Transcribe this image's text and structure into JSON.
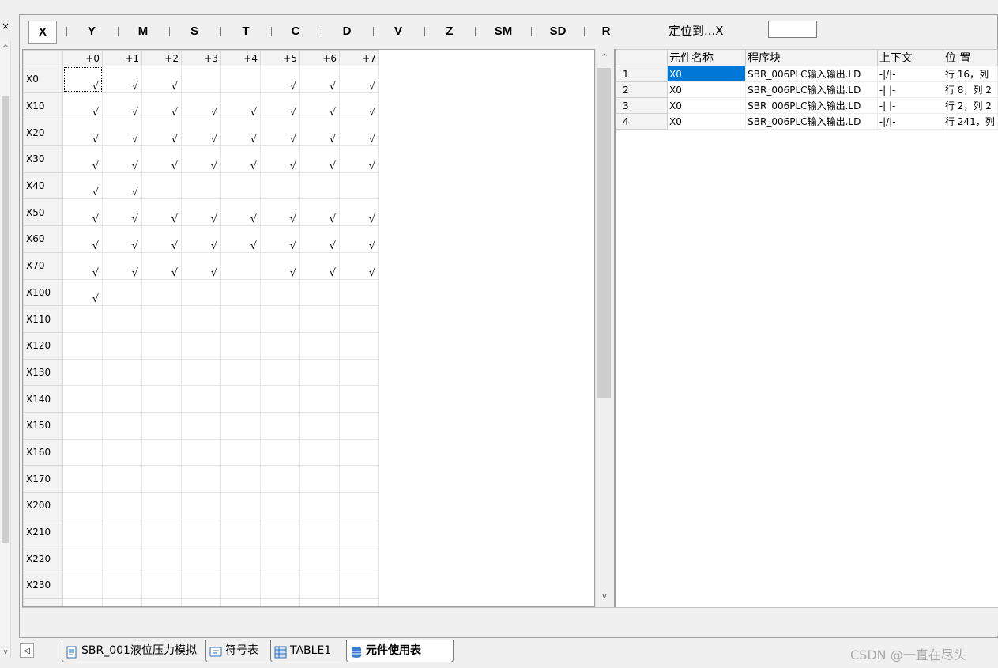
{
  "left_strip": {
    "close_glyph": "×",
    "up_glyph": "^",
    "down_glyph": "v"
  },
  "type_tabs": [
    {
      "label": "X",
      "active": true
    },
    {
      "label": "Y"
    },
    {
      "label": "M"
    },
    {
      "label": "S"
    },
    {
      "label": "T"
    },
    {
      "label": "C"
    },
    {
      "label": "D"
    },
    {
      "label": "V"
    },
    {
      "label": "Z"
    },
    {
      "label": "SM"
    },
    {
      "label": "SD"
    },
    {
      "label": "R"
    }
  ],
  "locate": {
    "label": "定位到...X",
    "value": ""
  },
  "grid": {
    "columns": [
      "+0",
      "+1",
      "+2",
      "+3",
      "+4",
      "+5",
      "+6",
      "+7"
    ],
    "check_mark": "√",
    "rows": [
      {
        "label": "X0",
        "used": [
          1,
          1,
          1,
          0,
          0,
          1,
          1,
          1
        ]
      },
      {
        "label": "X10",
        "used": [
          1,
          1,
          1,
          1,
          1,
          1,
          1,
          1
        ]
      },
      {
        "label": "X20",
        "used": [
          1,
          1,
          1,
          1,
          1,
          1,
          1,
          1
        ]
      },
      {
        "label": "X30",
        "used": [
          1,
          1,
          1,
          1,
          1,
          1,
          1,
          1
        ]
      },
      {
        "label": "X40",
        "used": [
          1,
          1,
          0,
          0,
          0,
          0,
          0,
          0
        ]
      },
      {
        "label": "X50",
        "used": [
          1,
          1,
          1,
          1,
          1,
          1,
          1,
          1
        ]
      },
      {
        "label": "X60",
        "used": [
          1,
          1,
          1,
          1,
          1,
          1,
          1,
          1
        ]
      },
      {
        "label": "X70",
        "used": [
          1,
          1,
          1,
          1,
          0,
          1,
          1,
          1
        ]
      },
      {
        "label": "X100",
        "used": [
          1,
          0,
          0,
          0,
          0,
          0,
          0,
          0
        ]
      },
      {
        "label": "X110",
        "used": [
          0,
          0,
          0,
          0,
          0,
          0,
          0,
          0
        ]
      },
      {
        "label": "X120",
        "used": [
          0,
          0,
          0,
          0,
          0,
          0,
          0,
          0
        ]
      },
      {
        "label": "X130",
        "used": [
          0,
          0,
          0,
          0,
          0,
          0,
          0,
          0
        ]
      },
      {
        "label": "X140",
        "used": [
          0,
          0,
          0,
          0,
          0,
          0,
          0,
          0
        ]
      },
      {
        "label": "X150",
        "used": [
          0,
          0,
          0,
          0,
          0,
          0,
          0,
          0
        ]
      },
      {
        "label": "X160",
        "used": [
          0,
          0,
          0,
          0,
          0,
          0,
          0,
          0
        ]
      },
      {
        "label": "X170",
        "used": [
          0,
          0,
          0,
          0,
          0,
          0,
          0,
          0
        ]
      },
      {
        "label": "X200",
        "used": [
          0,
          0,
          0,
          0,
          0,
          0,
          0,
          0
        ]
      },
      {
        "label": "X210",
        "used": [
          0,
          0,
          0,
          0,
          0,
          0,
          0,
          0
        ]
      },
      {
        "label": "X220",
        "used": [
          0,
          0,
          0,
          0,
          0,
          0,
          0,
          0
        ]
      },
      {
        "label": "X230",
        "used": [
          0,
          0,
          0,
          0,
          0,
          0,
          0,
          0
        ]
      },
      {
        "label": "",
        "used": [
          0,
          0,
          0,
          0,
          0,
          0,
          0,
          0
        ]
      }
    ]
  },
  "vscroll": {
    "up_glyph": "^",
    "down_glyph": "v"
  },
  "usage": {
    "headers": [
      "",
      "元件名称",
      "程序块",
      "上下文",
      "位 置"
    ],
    "rows": [
      {
        "idx": "1",
        "name": "X0",
        "block": "SBR_006PLC输入输出.LD",
        "context": "-|/|-",
        "position": "行 16，列"
      },
      {
        "idx": "2",
        "name": "X0",
        "block": "SBR_006PLC输入输出.LD",
        "context": "-| |-",
        "position": "行 8，列 2"
      },
      {
        "idx": "3",
        "name": "X0",
        "block": "SBR_006PLC输入输出.LD",
        "context": "-| |-",
        "position": "行 2，列 2"
      },
      {
        "idx": "4",
        "name": "X0",
        "block": "SBR_006PLC输入输出.LD",
        "context": "-|/|-",
        "position": "行 241，列"
      }
    ],
    "selected_row": 0
  },
  "bottom_tabs": {
    "nav_left": "◁",
    "tabs": [
      {
        "label": "SBR_001液位压力模拟",
        "icon": "ladder-program-icon"
      },
      {
        "label": "符号表",
        "icon": "symbol-table-icon"
      },
      {
        "label": "TABLE1",
        "icon": "table-icon"
      },
      {
        "label": "元件使用表",
        "icon": "database-icon",
        "active": true
      }
    ]
  },
  "watermark": "CSDN @一直在尽头"
}
